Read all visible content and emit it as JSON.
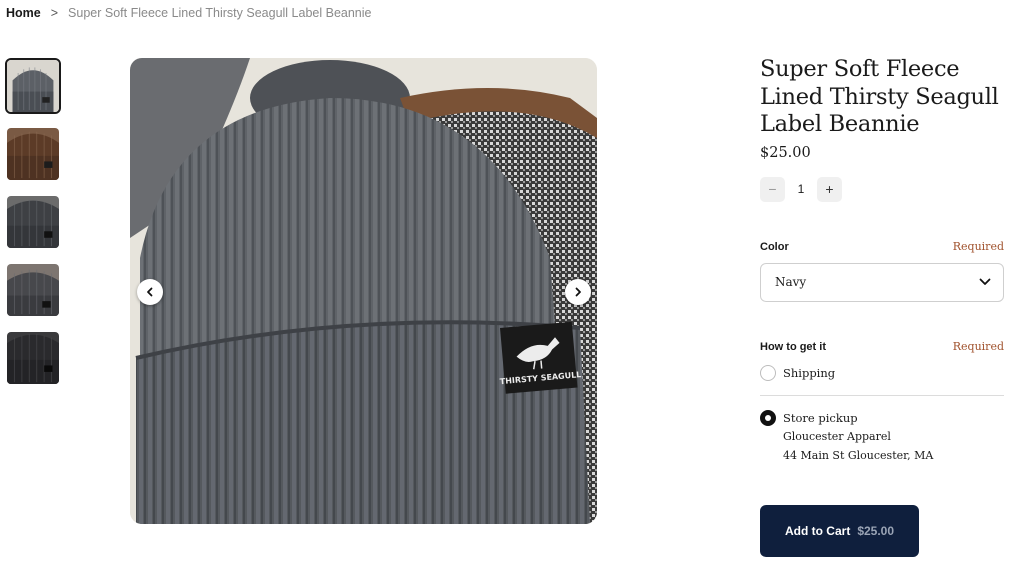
{
  "breadcrumb": {
    "home": "Home",
    "separator": ">",
    "current": "Super Soft Fleece Lined Thirsty Seagull Label Beannie"
  },
  "gallery": {
    "thumbnails": [
      {
        "alt": "gray beanie",
        "color": "#55595e"
      },
      {
        "alt": "brown beanie",
        "color": "#5a3a28"
      },
      {
        "alt": "charcoal beanie",
        "color": "#3c3d40"
      },
      {
        "alt": "dark beanie",
        "color": "#45464a"
      },
      {
        "alt": "black beanie",
        "color": "#2a2a2c"
      }
    ],
    "active_index": 0,
    "main_label_text": "THIRSTY SEAGULL",
    "prev_icon": "chevron-left-icon",
    "next_icon": "chevron-right-icon"
  },
  "product": {
    "title": "Super Soft Fleece Lined Thirsty Seagull Label Beannie",
    "price": "$25.00",
    "quantity": "1",
    "minus_label": "−",
    "plus_label": "+"
  },
  "color": {
    "label": "Color",
    "required": "Required",
    "selected": "Navy"
  },
  "fulfillment": {
    "label": "How to get it",
    "required": "Required",
    "shipping": "Shipping",
    "pickup": "Store pickup",
    "store_name": "Gloucester Apparel",
    "store_address": "44 Main St Gloucester, MA",
    "selected": "pickup"
  },
  "cart": {
    "label": "Add to Cart",
    "price": "$25.00"
  },
  "colors": {
    "cart_button": "#0f1f3d",
    "required_text": "#a0522d"
  }
}
